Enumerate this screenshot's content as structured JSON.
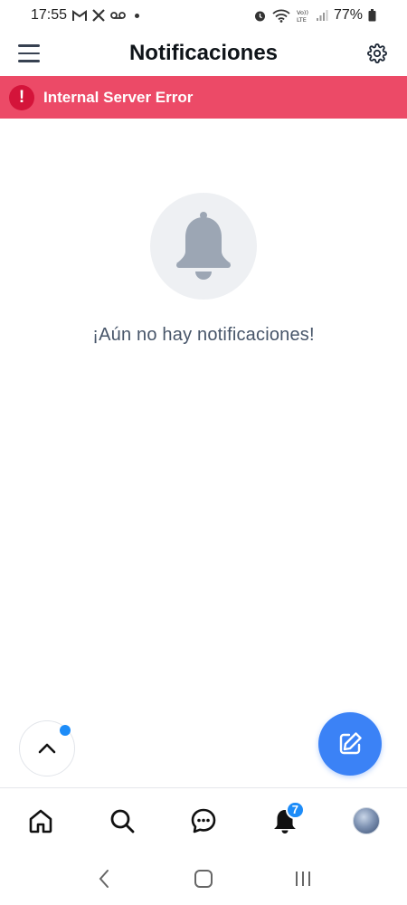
{
  "status_bar": {
    "time": "17:55",
    "battery": "77%",
    "notif_icons": [
      "gmail-icon",
      "x-icon",
      "voicemail-icon"
    ],
    "system_icons": [
      "alarm-icon",
      "wifi-icon",
      "volte-icon",
      "signal-icon",
      "battery-icon"
    ]
  },
  "header": {
    "title": "Notificaciones",
    "menu_icon": "hamburger-menu-icon",
    "settings_icon": "gear-icon"
  },
  "error_banner": {
    "icon": "!",
    "message": "Internal Server Error",
    "color": "#ec4a67"
  },
  "empty_state": {
    "icon": "bell-icon",
    "message": "¡Aún no hay notificaciones!"
  },
  "floating": {
    "scroll_top_icon": "chevron-up-icon",
    "compose_icon": "compose-icon",
    "compose_color": "#3b82f6"
  },
  "bottom_nav": {
    "items": [
      {
        "name": "home",
        "icon": "home-icon"
      },
      {
        "name": "search",
        "icon": "search-icon"
      },
      {
        "name": "messages",
        "icon": "chat-icon"
      },
      {
        "name": "notifications",
        "icon": "bell-icon",
        "badge": "7"
      },
      {
        "name": "profile",
        "icon": "avatar"
      }
    ]
  },
  "android_nav": [
    "back-icon",
    "home-circle-icon",
    "recents-icon"
  ]
}
